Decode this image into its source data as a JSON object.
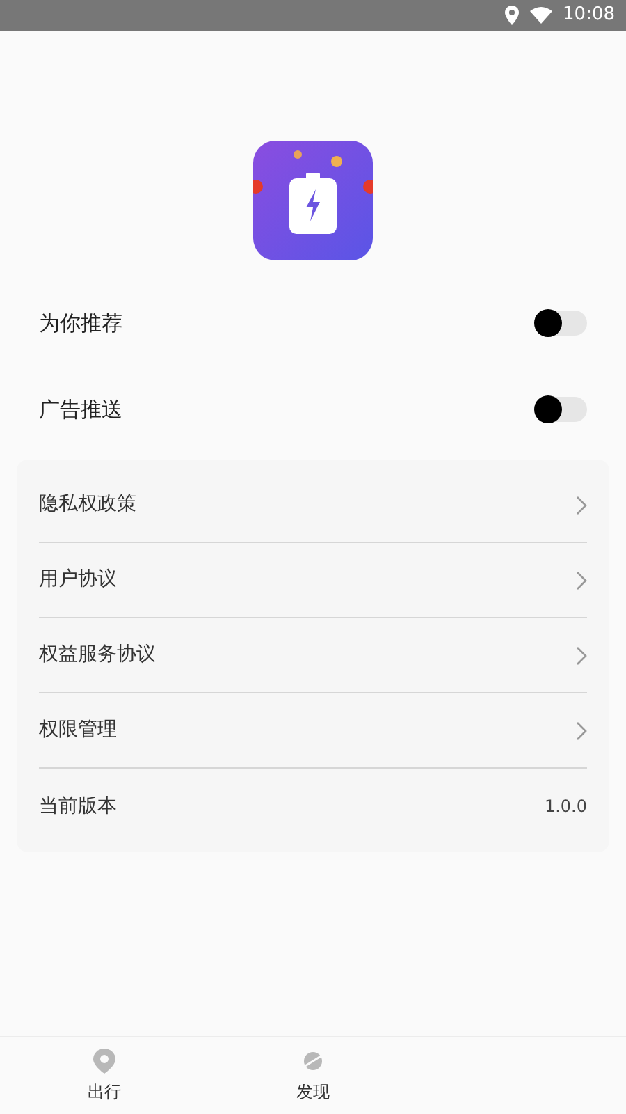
{
  "status_bar": {
    "time": "10:08"
  },
  "toggles": [
    {
      "label": "为你推荐",
      "on": false
    },
    {
      "label": "广告推送",
      "on": false
    }
  ],
  "menu": [
    {
      "kind": "link",
      "label": "隐私权政策"
    },
    {
      "kind": "link",
      "label": "用户协议"
    },
    {
      "kind": "link",
      "label": "权益服务协议"
    },
    {
      "kind": "link",
      "label": "权限管理"
    },
    {
      "kind": "value",
      "label": "当前版本",
      "value": "1.0.0"
    }
  ],
  "tabs": [
    {
      "label": "出行",
      "kind": "pin",
      "selected": false
    },
    {
      "label": "发现",
      "kind": "planet",
      "selected": false
    }
  ]
}
